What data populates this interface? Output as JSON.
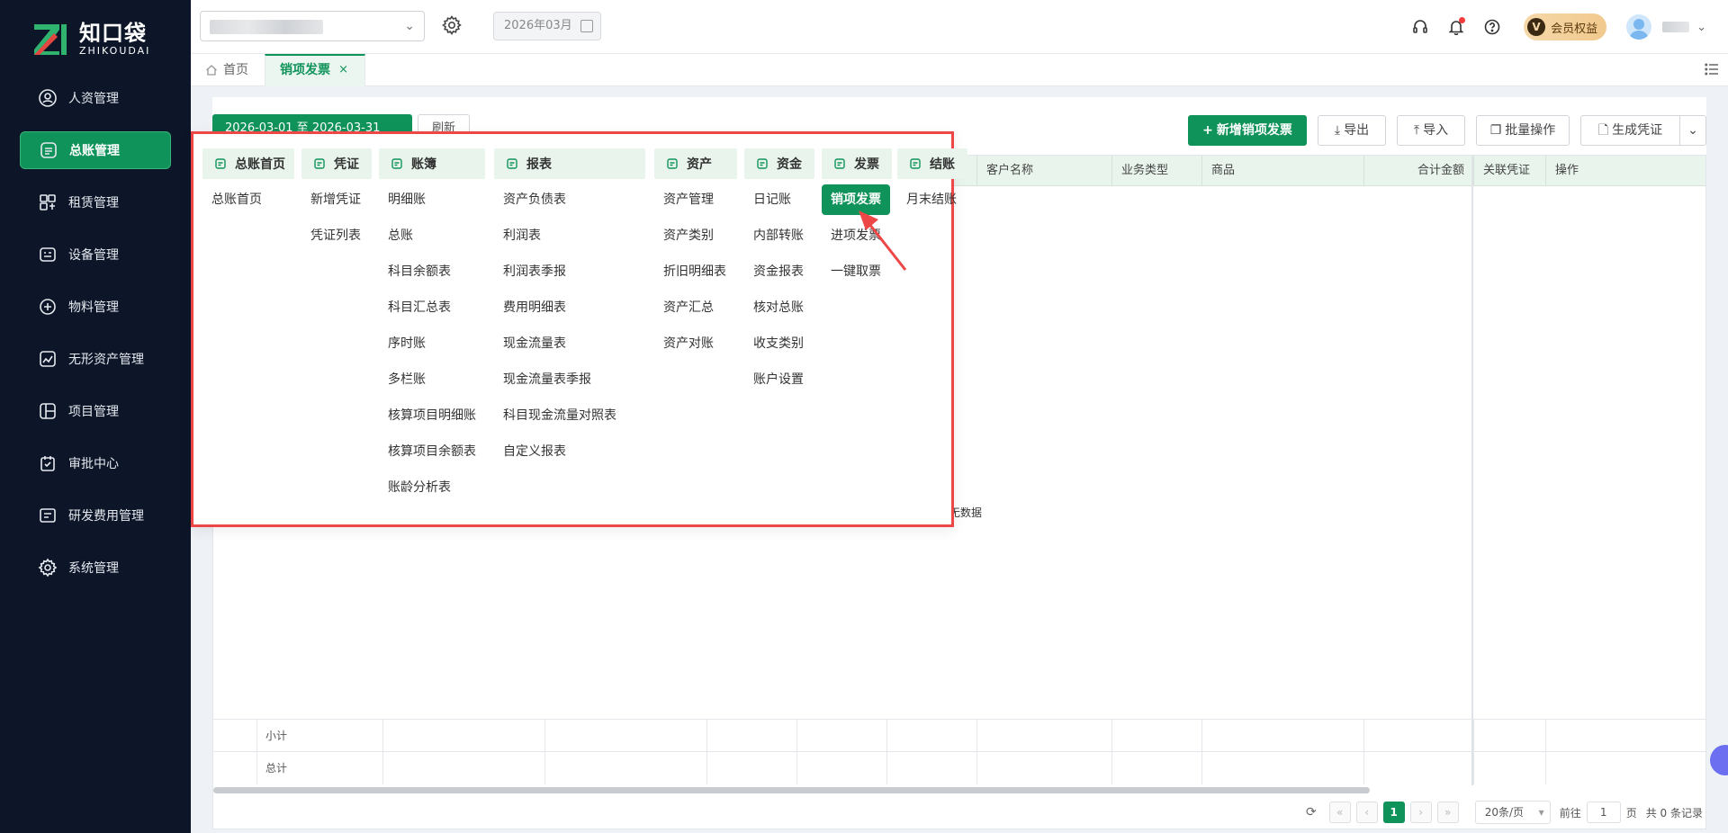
{
  "app": {
    "logo_cn": "知口袋",
    "logo_en": "ZHIKOUDAI",
    "brand_color": "#10935a",
    "highlight_color": "#ee4747"
  },
  "sidebar": {
    "items": [
      {
        "label": "人资管理",
        "icon": "person-icon"
      },
      {
        "label": "总账管理",
        "icon": "ledger-icon",
        "active": true
      },
      {
        "label": "租赁管理",
        "icon": "lease-icon"
      },
      {
        "label": "设备管理",
        "icon": "device-icon"
      },
      {
        "label": "物料管理",
        "icon": "material-icon"
      },
      {
        "label": "无形资产管理",
        "icon": "intangible-icon"
      },
      {
        "label": "项目管理",
        "icon": "project-icon"
      },
      {
        "label": "审批中心",
        "icon": "approval-icon"
      },
      {
        "label": "研发费用管理",
        "icon": "rd-icon"
      },
      {
        "label": "系统管理",
        "icon": "settings-icon"
      }
    ]
  },
  "topbar": {
    "month": "2026年03月",
    "vip_badge": "V",
    "vip_label": "会员权益"
  },
  "tabs": {
    "home": "首页",
    "active": "销项发票",
    "close": "×"
  },
  "toolbar": {
    "date_range": "2026-03-01 至 2026-03-31",
    "refresh": "刷新",
    "add_button": "新增销项发票",
    "add_icon": "+",
    "export": "导出",
    "import": "导入",
    "batch": "批量操作",
    "generate": "生成凭证"
  },
  "grid": {
    "columns": [
      "客户名称",
      "业务类型",
      "商品",
      "合计金额",
      "关联凭证",
      "操作"
    ],
    "empty_text": "无数据",
    "subtotal": "小计",
    "total": "总计"
  },
  "pager": {
    "current_page": "1",
    "page_size": "20条/页",
    "goto_prefix": "前往",
    "goto_value": "1",
    "goto_suffix": "页",
    "total": "共 0 条记录"
  },
  "mega_menu": {
    "columns": [
      {
        "title": "总账首页",
        "icon": "home-ledger-icon",
        "items": [
          "总账首页"
        ]
      },
      {
        "title": "凭证",
        "icon": "voucher-icon",
        "items": [
          "新增凭证",
          "凭证列表"
        ]
      },
      {
        "title": "账簿",
        "icon": "book-icon",
        "items": [
          "明细账",
          "总账",
          "科目余额表",
          "科目汇总表",
          "序时账",
          "多栏账",
          "核算项目明细账",
          "核算项目余额表",
          "账龄分析表"
        ]
      },
      {
        "title": "报表",
        "icon": "report-icon",
        "items": [
          "资产负债表",
          "利润表",
          "利润表季报",
          "费用明细表",
          "现金流量表",
          "现金流量表季报",
          "科目现金流量对照表",
          "自定义报表"
        ]
      },
      {
        "title": "资产",
        "icon": "asset-icon",
        "items": [
          "资产管理",
          "资产类别",
          "折旧明细表",
          "资产汇总",
          "资产对账"
        ]
      },
      {
        "title": "资金",
        "icon": "fund-icon",
        "items": [
          "日记账",
          "内部转账",
          "资金报表",
          "核对总账",
          "收支类别",
          "账户设置"
        ]
      },
      {
        "title": "发票",
        "icon": "invoice-icon",
        "items": [
          "销项发票",
          "进项发票",
          "一键取票"
        ],
        "selected": "销项发票"
      },
      {
        "title": "结账",
        "icon": "close-period-icon",
        "items": [
          "月末结账"
        ]
      }
    ]
  }
}
